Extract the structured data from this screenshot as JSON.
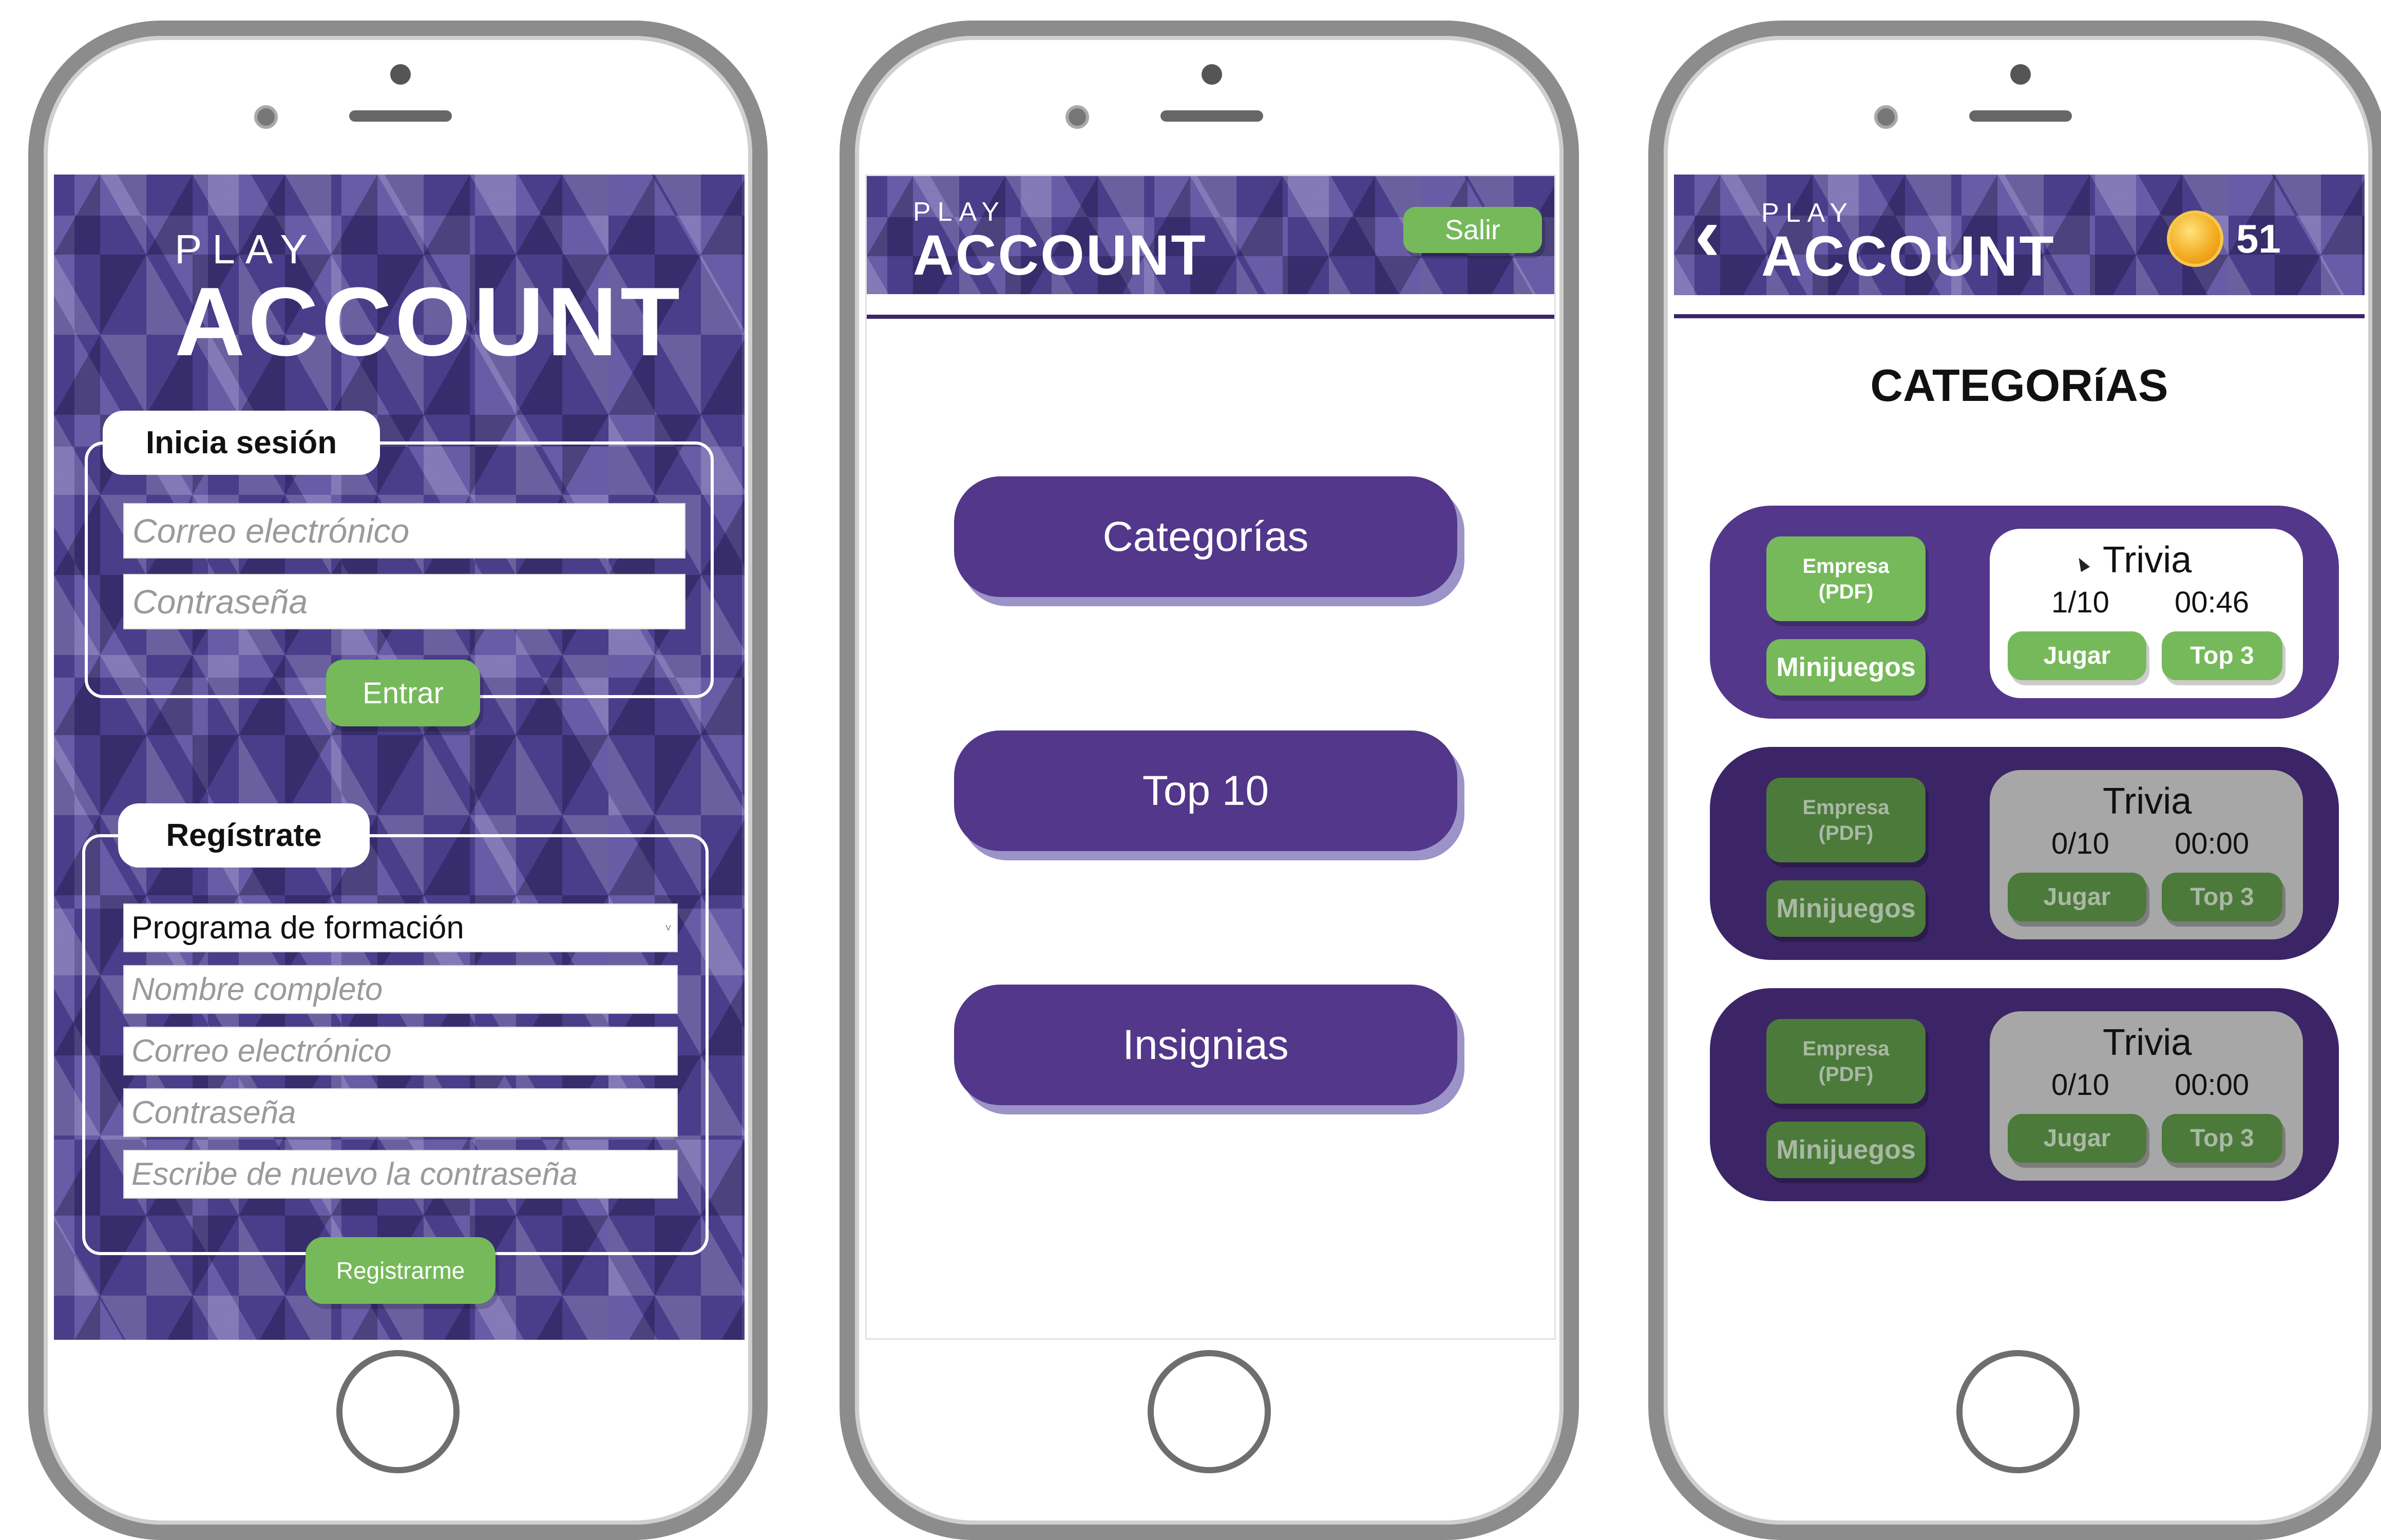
{
  "brand": {
    "play": "PLAY",
    "account": "ACCOUNT"
  },
  "colors": {
    "purple": "#52378a",
    "purple_dark": "#3b2566",
    "green": "#76b95a",
    "phone_frame": "#8c8c8c"
  },
  "screen1": {
    "login": {
      "title": "Inicia sesión",
      "email_placeholder": "Correo electrónico",
      "password_placeholder": "Contraseña",
      "submit": "Entrar"
    },
    "register": {
      "title": "Regístrate",
      "program_select": "Programa de formación",
      "name_placeholder": "Nombre completo",
      "email_placeholder": "Correo electrónico",
      "password_placeholder": "Contraseña",
      "repeat_placeholder": "Escribe de nuevo la contraseña",
      "submit": "Registrarme"
    }
  },
  "screen2": {
    "logout": "Salir",
    "menu": [
      "Categorías",
      "Top 10",
      "Insignias"
    ]
  },
  "screen3": {
    "back_icon": "chevron-left-icon",
    "coin_icon": "coin-icon",
    "coins": "51",
    "title": "CATEGORíAS",
    "cards": [
      {
        "company": "Empresa\n(PDF)",
        "minigames": "Minijuegos",
        "trivia": "Trivia",
        "progress": "1/10",
        "time": "00:46",
        "play": "Jugar",
        "top": "Top 3",
        "enabled": true
      },
      {
        "company": "Empresa\n(PDF)",
        "minigames": "Minijuegos",
        "trivia": "Trivia",
        "progress": "0/10",
        "time": "00:00",
        "play": "Jugar",
        "top": "Top 3",
        "enabled": false
      },
      {
        "company": "Empresa\n(PDF)",
        "minigames": "Minijuegos",
        "trivia": "Trivia",
        "progress": "0/10",
        "time": "00:00",
        "play": "Jugar",
        "top": "Top 3",
        "enabled": false
      }
    ]
  }
}
